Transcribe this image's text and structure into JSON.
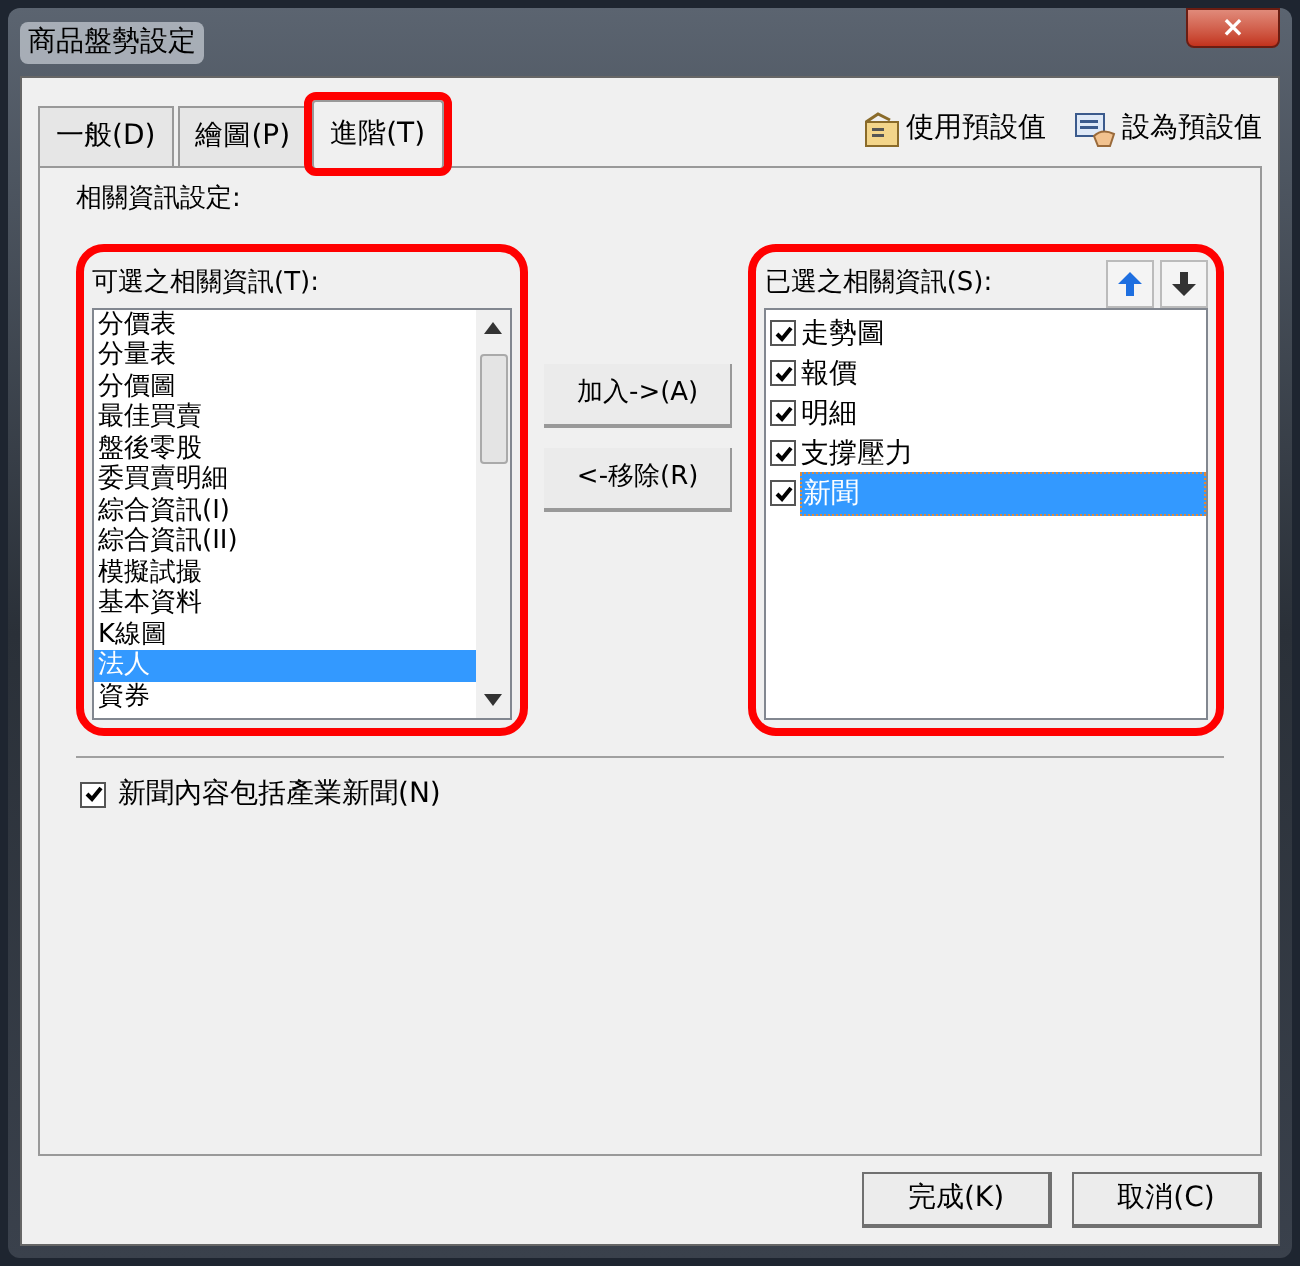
{
  "window": {
    "title": "商品盤勢設定",
    "close": "×"
  },
  "tabs": [
    {
      "label": "一般(D)",
      "selected": false,
      "annotated": false
    },
    {
      "label": "繪圖(P)",
      "selected": false,
      "annotated": false
    },
    {
      "label": "進階(T)",
      "selected": true,
      "annotated": true
    }
  ],
  "toolbar": [
    {
      "label": "使用預設值",
      "kind": "use"
    },
    {
      "label": "設為預設值",
      "kind": "set"
    }
  ],
  "section_label": "相關資訊設定:",
  "available": {
    "label": "可選之相關資訊(T):",
    "annotated": true,
    "items": [
      {
        "label": "分價表",
        "selected": false
      },
      {
        "label": "分量表",
        "selected": false
      },
      {
        "label": "分價圖",
        "selected": false
      },
      {
        "label": "最佳買賣",
        "selected": false
      },
      {
        "label": "盤後零股",
        "selected": false
      },
      {
        "label": "委買賣明細",
        "selected": false
      },
      {
        "label": "綜合資訊(I)",
        "selected": false
      },
      {
        "label": "綜合資訊(II)",
        "selected": false
      },
      {
        "label": "模擬試撮",
        "selected": false
      },
      {
        "label": "基本資料",
        "selected": false
      },
      {
        "label": "K線圖",
        "selected": false
      },
      {
        "label": "法人",
        "selected": true
      },
      {
        "label": "資券",
        "selected": false
      }
    ]
  },
  "move_buttons": [
    "加入->(A)",
    "<-移除(R)"
  ],
  "chosen": {
    "label": "已選之相關資訊(S):",
    "annotated": true,
    "items": [
      {
        "label": "走勢圖",
        "checked": true,
        "selected": false
      },
      {
        "label": "報價",
        "checked": true,
        "selected": false
      },
      {
        "label": "明細",
        "checked": true,
        "selected": false
      },
      {
        "label": "支撐壓力",
        "checked": true,
        "selected": false
      },
      {
        "label": "新聞",
        "checked": true,
        "selected": true
      }
    ]
  },
  "include_industry_news": {
    "label": "新聞內容包括產業新聞(N)",
    "checked": true
  },
  "buttons": [
    "完成(K)",
    "取消(C)"
  ]
}
